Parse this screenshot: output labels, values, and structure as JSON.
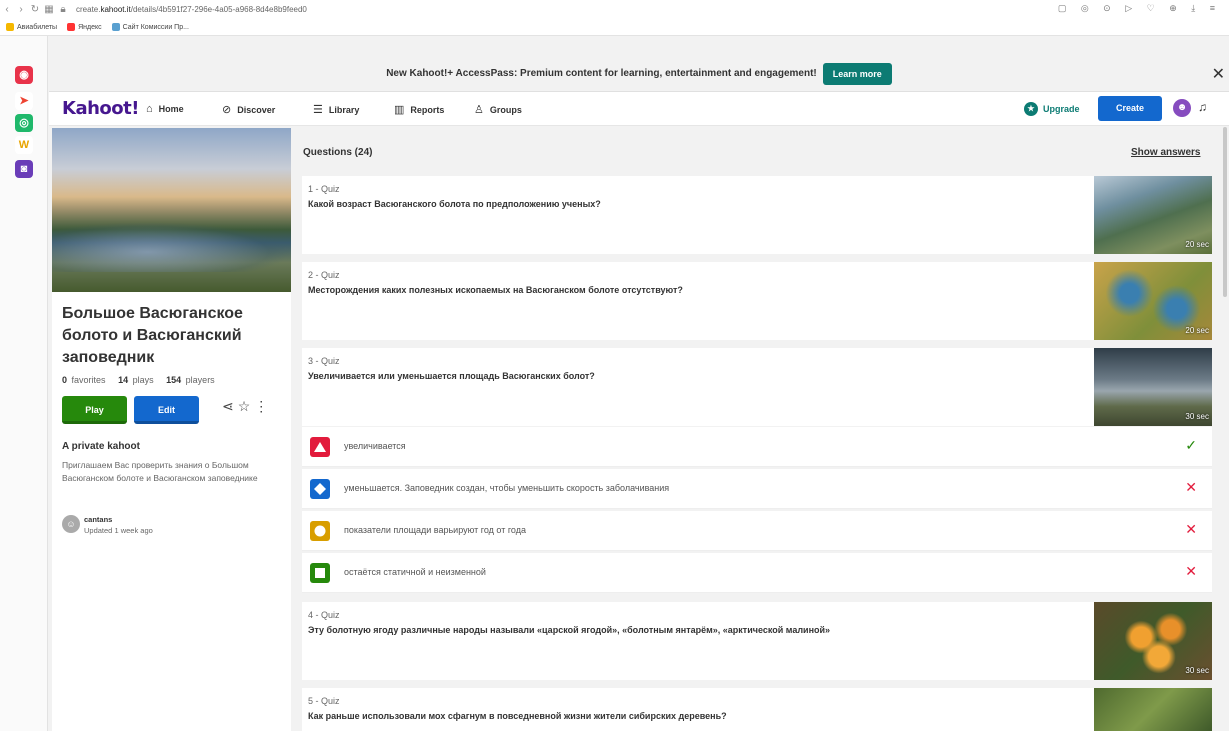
{
  "browser": {
    "url_prefix": "create.",
    "url_domain": "kahoot.it",
    "url_path": "/details/4b591f27-296e-4a05-a968-8d4e8b9feed0",
    "bookmarks": [
      "Авиабилеты",
      "Яндекс",
      "Сайт Комиссии Пр..."
    ]
  },
  "banner": {
    "text": "New Kahoot!+ AccessPass: Premium content for learning, entertainment and engagement!",
    "learn_more": "Learn more",
    "close": "✕"
  },
  "nav": {
    "logo": "Kahoot!",
    "items": [
      {
        "label": "Home",
        "icon": "⌂"
      },
      {
        "label": "Discover",
        "icon": "⊘"
      },
      {
        "label": "Library",
        "icon": "☰"
      },
      {
        "label": "Reports",
        "icon": "▥"
      },
      {
        "label": "Groups",
        "icon": "♙"
      }
    ],
    "upgrade": "Upgrade",
    "create": "Create"
  },
  "kahoot": {
    "title": "Большое Васюганское болото и Васюганский заповедник",
    "favorites_count": "0",
    "favorites_label": "favorites",
    "plays_count": "14",
    "plays_label": "plays",
    "players_count": "154",
    "players_label": "players",
    "play": "Play",
    "edit": "Edit",
    "visibility": "A private kahoot",
    "description": "Приглашаем Вас проверить знания о Большом Васюганском болоте и Васюганском заповеднике",
    "creator": "cantans",
    "updated": "Updated 1 week ago"
  },
  "questions_header": "Questions (24)",
  "show_answers": "Show answers",
  "questions": [
    {
      "type": "1 - Quiz",
      "text": "Какой возраст Васюганского болота по предположению ученых?",
      "time": "20 sec"
    },
    {
      "type": "2 - Quiz",
      "text": "Месторождения каких полезных ископаемых на Васюганском болоте отсутствуют?",
      "time": "20 sec"
    },
    {
      "type": "3 - Quiz",
      "text": "Увеличивается или уменьшается площадь Васюганских болот?",
      "time": "30 sec"
    },
    {
      "type": "4 - Quiz",
      "text": "Эту болотную ягоду различные народы называли «царской ягодой», «болотным янтарём», «арктической малиной»",
      "time": "30 sec"
    },
    {
      "type": "5 - Quiz",
      "text": "Как раньше использовали мох сфагнум в повседневной жизни жители сибирских деревень?",
      "time": ""
    }
  ],
  "answers": [
    {
      "text": "увеличивается",
      "correct": true,
      "shape": "triangle",
      "color": "#e21b3c"
    },
    {
      "text": "уменьшается. Заповедник создан, чтобы уменьшить скорость заболачивания",
      "correct": false,
      "shape": "diamond",
      "color": "#1368ce"
    },
    {
      "text": "показатели площади варьируют год от года",
      "correct": false,
      "shape": "circle",
      "color": "#d89e00"
    },
    {
      "text": "остаётся статичной и неизменной",
      "correct": false,
      "shape": "square",
      "color": "#26890c"
    }
  ],
  "marks": {
    "correct": "✓",
    "wrong": "✕"
  }
}
